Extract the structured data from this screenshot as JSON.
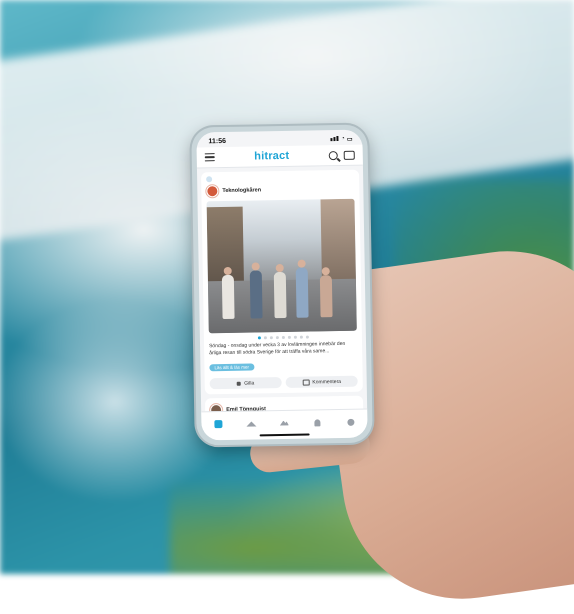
{
  "status_bar": {
    "time": "11:56"
  },
  "app": {
    "logo_text": "hitract",
    "accent_color": "#1fa5d6"
  },
  "post": {
    "author": "Teknologkåren",
    "text": "Söndag - onsdag under vecka 3 av lovlämningen innebär den årliga resan till södra Sverige för att träffa våra same...",
    "read_more": "Läs allt & läs mer",
    "carousel_pages": 9,
    "carousel_active": 1,
    "like_label": "Gilla",
    "comment_label": "Kommentera"
  },
  "next_post": {
    "author": "Emil Tönnquist"
  },
  "tabs": [
    "hitract-home-tab",
    "home-tab",
    "explore-tab",
    "notifications-tab",
    "profile-tab"
  ]
}
